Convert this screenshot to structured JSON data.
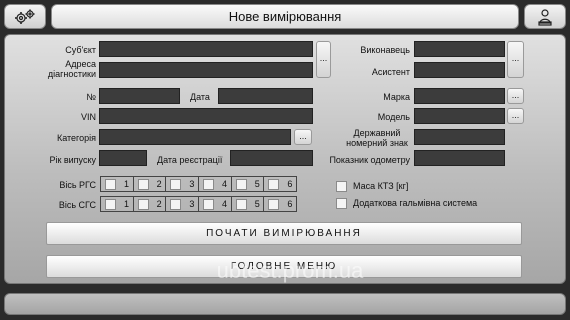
{
  "header": {
    "title": "Нове вимірювання",
    "settings_icon": "gears-icon",
    "user_icon": "user-doc-icon"
  },
  "form": {
    "subject_label": "Суб'єкт",
    "address_label": "Адреса\nдіагностики",
    "number_label": "№",
    "date_label": "Дата",
    "vin_label": "VIN",
    "category_label": "Категорія",
    "year_label": "Рік випуску",
    "reg_date_label": "Дата реєстрації",
    "performer_label": "Виконавець",
    "assistant_label": "Асистент",
    "brand_label": "Марка",
    "model_label": "Модель",
    "plate_label": "Державний\nномерний знак",
    "odometer_label": "Показник одометру",
    "browse_label": "...",
    "subject_value": "",
    "address_value": "",
    "number_value": "",
    "date_value": "",
    "vin_value": "",
    "category_value": "",
    "year_value": "",
    "reg_date_value": "",
    "performer_value": "",
    "assistant_value": "",
    "brand_value": "",
    "model_value": "",
    "plate_value": "",
    "odometer_value": ""
  },
  "axes": {
    "rgs_label": "Вісь РГС",
    "sgs_label": "Вісь СГС",
    "numbers": [
      "1",
      "2",
      "3",
      "4",
      "5",
      "6"
    ]
  },
  "options": {
    "kts_mass_label": "Маса КТЗ [кг]",
    "extra_brake_label": "Додаткова гальмівна система"
  },
  "actions": {
    "start_label": "ПОЧАТИ ВИМІРЮВАННЯ",
    "menu_label": "ГОЛОВНЕ МЕНЮ"
  },
  "watermark": "ubtest.prom.ua"
}
